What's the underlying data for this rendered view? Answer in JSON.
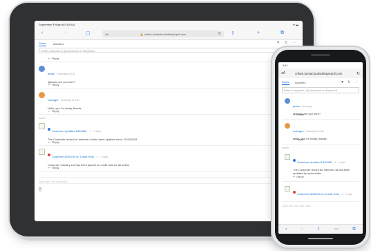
{
  "tablet": {
    "status_left": "September Friday at 9:16 AM",
    "status_right": "▪▪ ▬",
    "toolbar_icons": {
      "back": "‹",
      "forward": "›",
      "sidebar": "▢",
      "share": "⇧",
      "new_tab": "+",
      "tabs": "⧉"
    },
    "url_aA": "aA",
    "url": "crfiam.lumiacloudsdetapicpcli.com",
    "tabs": [
      "Share",
      "Activities"
    ],
    "tab_icons": "▼ ↻ ⋯",
    "compose_placeholder": "Enter a keyword | @username or #keyword",
    "reply_label": "Reply",
    "posts": [
      {
        "name": "jessie",
        "time": "Yesterday at 3:41",
        "text": "@jessie are you here?",
        "avatar_color": "#5b8fd6"
      },
      {
        "name": "manager",
        "time": "Yesterday at 3:42",
        "text": "Hello, yes I'm ready, thanks",
        "avatar_color": "#e69a47"
      }
    ],
    "divider": "Earlier",
    "cards": [
      {
        "title": "Customer Updated 1820356",
        "meta": "· 1 · 2 days",
        "body": "The Customer record for Internet Ltd has been updated since 11/15/2018",
        "dot_color": "#2f7de1"
      },
      {
        "title": "Customer 8200239 on Credit Hold",
        "meta": "· 1 · 2 days",
        "body": "Customer Industry Ltd has been placed on credit hold for all orders",
        "dot_color": "#d9433a"
      }
    ],
    "footer_placeholder": "Type here for new data...",
    "footer_icon": "⎘"
  },
  "phone": {
    "status": "9:41",
    "url_aA": "aA",
    "url": "crfiam.lumiacloudsdetapicpcli.com",
    "tabs": [
      "Share",
      "Activities"
    ],
    "tab_icons": "▼ ↻ ⋯",
    "compose_placeholder": "Enter a keyword | @username or #keyword",
    "reply_label": "Reply",
    "posts": [
      {
        "name": "jessie",
        "time": "Yesterday",
        "text": "@jessie are you here?",
        "avatar_color": "#5b8fd6"
      },
      {
        "name": "manager",
        "time": "Yesterday at 3:42",
        "text": "Hello, yes I'm ready, thanks",
        "avatar_color": "#e69a47"
      }
    ],
    "divider": "Earlier",
    "cards": [
      {
        "title": "Customer Updated 1820356",
        "meta": "· 1 · 2 days",
        "body": "The Customer record for Internet Ltd has been updated by hyclouddev",
        "dot_color": "#2f7de1"
      },
      {
        "title": "Customer 8200239 on Credit Hold",
        "meta": "· 1 · 2 days",
        "body": "",
        "dot_color": "#d9433a"
      }
    ],
    "footer_placeholder": "Type here for new data...",
    "bottom_icons": {
      "back": "‹",
      "forward": "›",
      "share": "⇧",
      "bookmarks": "▭",
      "tabs": "⧉"
    }
  }
}
